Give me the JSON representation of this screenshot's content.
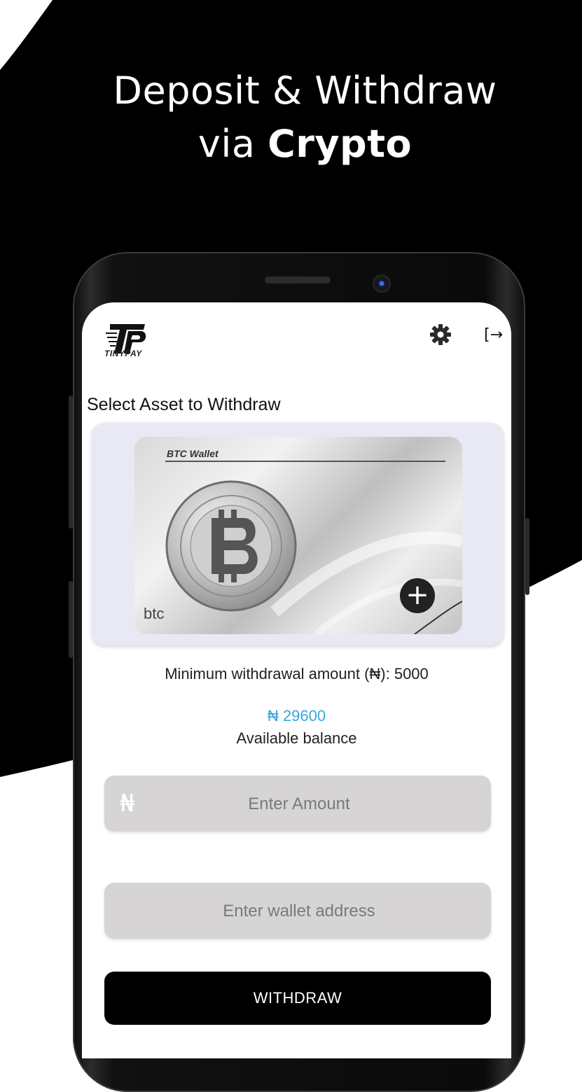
{
  "promo": {
    "headline_line1": "Deposit & Withdraw",
    "headline_prefix": "via ",
    "headline_strong": "Crypto"
  },
  "app": {
    "brand": "TINYPAY",
    "header_icons": [
      "gear-icon",
      "logout-icon"
    ],
    "logout_glyph": "[→"
  },
  "withdraw": {
    "section_title": "Select Asset to Withdraw",
    "asset_card": {
      "wallet_title": "BTC Wallet",
      "symbol": "btc",
      "add_glyph": "+"
    },
    "min_text": "Minimum withdrawal amount (₦): 5000",
    "balance_amount": "₦ 29600",
    "balance_label": "Available balance",
    "amount_field": {
      "currency_glyph": "₦",
      "placeholder": "Enter Amount"
    },
    "address_field": {
      "placeholder": "Enter wallet address"
    },
    "withdraw_label": "WITHDRAW"
  },
  "colors": {
    "accent_blue": "#3aa7d8",
    "field_bg": "#d6d4d4",
    "button_bg": "#000000"
  }
}
